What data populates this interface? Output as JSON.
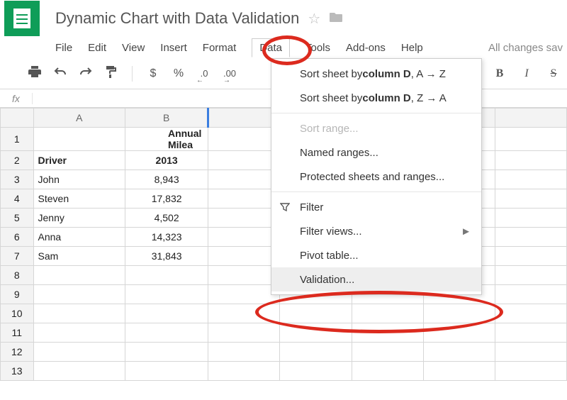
{
  "doc": {
    "title": "Dynamic Chart with Data Validation",
    "save_status": "All changes sav"
  },
  "menu": {
    "file": "File",
    "edit": "Edit",
    "view": "View",
    "insert": "Insert",
    "format": "Format",
    "data": "Data",
    "tools": "Tools",
    "addons": "Add-ons",
    "help": "Help"
  },
  "toolbar": {
    "dollar": "$",
    "percent": "%",
    "dec_less": ".0",
    "dec_more": ".00",
    "bold": "B",
    "italic": "I",
    "strike": "S"
  },
  "data_menu": {
    "sort_asc_prefix": "Sort sheet by ",
    "sort_asc_col": "column D",
    "sort_asc_suffix": ", A → Z",
    "sort_desc_prefix": "Sort sheet by ",
    "sort_desc_col": "column D",
    "sort_desc_suffix": ", Z → A",
    "sort_range": "Sort range...",
    "named": "Named ranges...",
    "protected": "Protected sheets and ranges...",
    "filter": "Filter",
    "filter_views": "Filter views...",
    "pivot": "Pivot table...",
    "validation": "Validation..."
  },
  "columns": {
    "A": "A",
    "B": "B"
  },
  "rows": {
    "r1": "1",
    "r2": "2",
    "r3": "3",
    "r4": "4",
    "r5": "5",
    "r6": "6",
    "r7": "7",
    "r8": "8",
    "r9": "9",
    "r10": "10",
    "r11": "11",
    "r12": "12",
    "r13": "13"
  },
  "cells": {
    "b1": "Annual Milea",
    "a2": "Driver",
    "b2": "2013",
    "a3": "John",
    "b3": "8,943",
    "a4": "Steven",
    "b4": "17,832",
    "a5": "Jenny",
    "b5": "4,502",
    "a6": "Anna",
    "b6": "14,323",
    "a7": "Sam",
    "b7": "31,843"
  },
  "chart_data": {
    "type": "table",
    "title": "Annual Mileage",
    "columns": [
      "Driver",
      "2013"
    ],
    "rows": [
      [
        "John",
        8943
      ],
      [
        "Steven",
        17832
      ],
      [
        "Jenny",
        4502
      ],
      [
        "Anna",
        14323
      ],
      [
        "Sam",
        31843
      ]
    ]
  }
}
